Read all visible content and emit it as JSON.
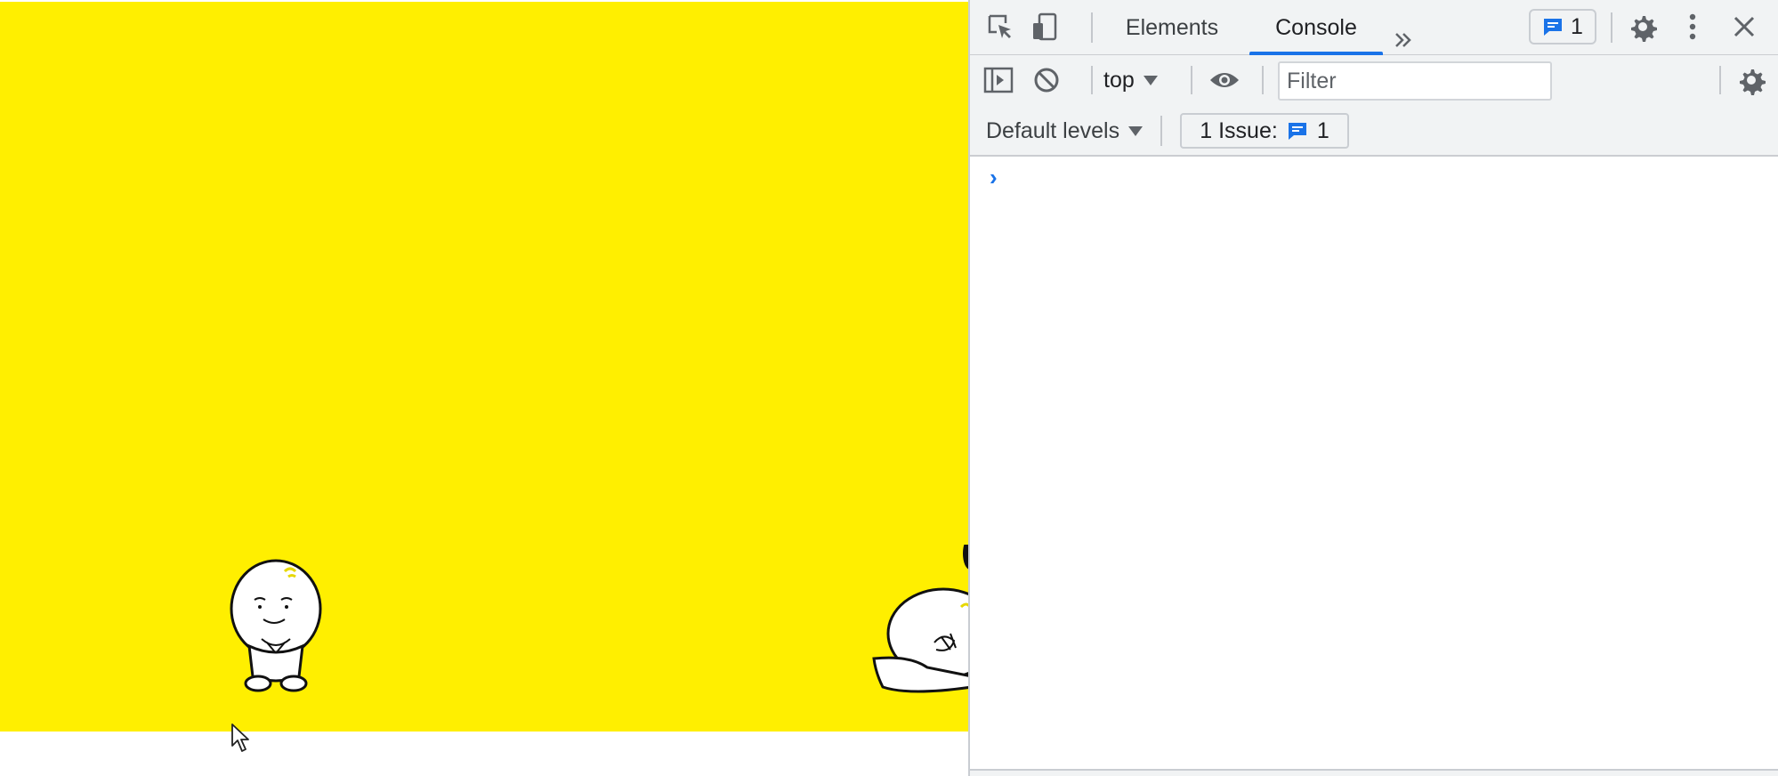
{
  "page": {
    "stage_color": "#ffef00",
    "sprites": [
      {
        "name": "standing-character"
      },
      {
        "name": "slug-character"
      }
    ]
  },
  "devtools": {
    "tabs": [
      {
        "label": "Elements",
        "active": false
      },
      {
        "label": "Console",
        "active": true
      }
    ],
    "issues_count": "1",
    "toolbar": {
      "context": "top",
      "filter_placeholder": "Filter"
    },
    "levels": {
      "label": "Default levels",
      "issues_label": "1 Issue:",
      "issues_count": "1"
    },
    "prompt_symbol": "›",
    "accent_color": "#1a73e8"
  }
}
